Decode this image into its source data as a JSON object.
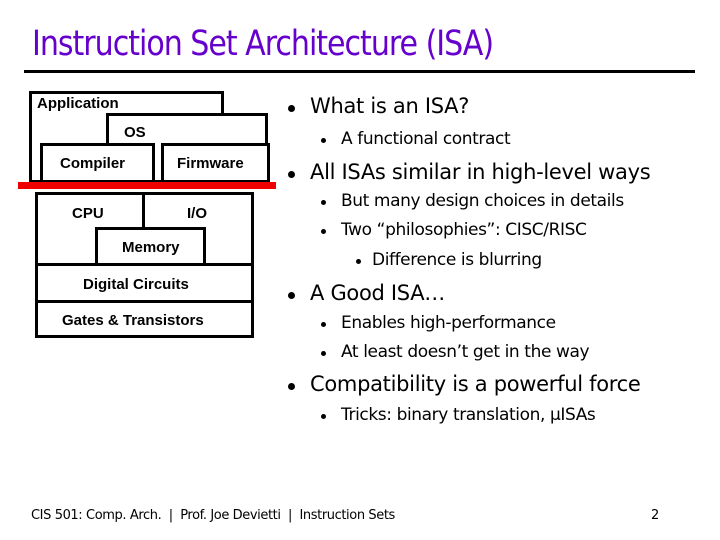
{
  "slide": {
    "title": "Instruction Set Architecture (ISA)",
    "title_color": "#6600CC",
    "accent_color": "#EE0000"
  },
  "diagram": {
    "upper_layers": {
      "application": "Application",
      "os": "OS",
      "compiler": "Compiler",
      "firmware": "Firmware"
    },
    "lower_layers": {
      "cpu": "CPU",
      "io": "I/O",
      "memory": "Memory",
      "digital_circuits": "Digital Circuits",
      "gates_transistors": "Gates & Transistors"
    }
  },
  "bullets": [
    {
      "level": 1,
      "text": "What is an ISA?"
    },
    {
      "level": 2,
      "text": "A functional contract"
    },
    {
      "level": 1,
      "text": "All ISAs similar in high-level ways"
    },
    {
      "level": 2,
      "text": "But many design choices in details"
    },
    {
      "level": 2,
      "text": "Two “philosophies”: CISC/RISC"
    },
    {
      "level": 3,
      "text": "Difference is blurring"
    },
    {
      "level": 1,
      "text": "A Good ISA…"
    },
    {
      "level": 2,
      "text": "Enables high-performance"
    },
    {
      "level": 2,
      "text": "At least doesn’t get in the way"
    },
    {
      "level": 1,
      "text": "Compatibility is a powerful force"
    },
    {
      "level": 2,
      "text": "Tricks: binary translation, μISAs"
    }
  ],
  "footer": {
    "text": "CIS 501: Comp. Arch.  |  Prof. Joe Devietti  |  Instruction Sets",
    "page_number": "2"
  }
}
